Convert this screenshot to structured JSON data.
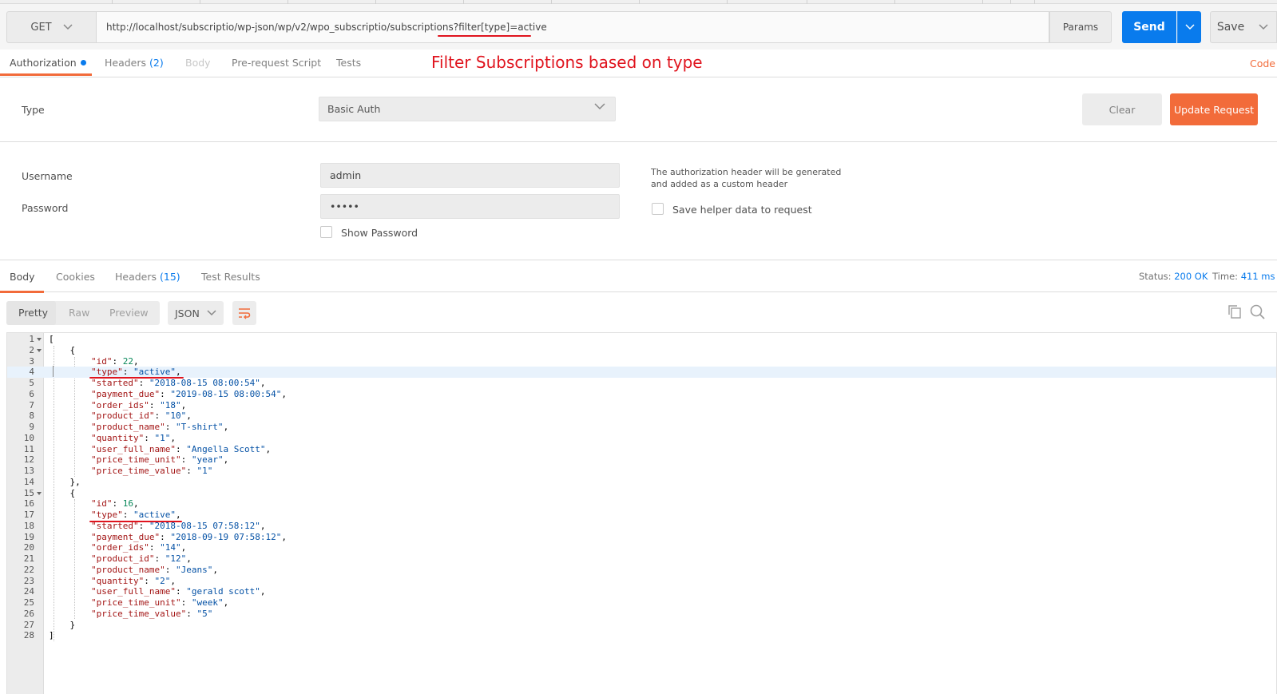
{
  "request": {
    "method": "GET",
    "url": "http://localhost/subscriptio/wp-json/wp/v2/wpo_subscriptio/subscriptions?filter[type]=active",
    "params_label": "Params",
    "send_label": "Send",
    "save_label": "Save"
  },
  "request_tabs": {
    "authorization": "Authorization",
    "headers": "Headers",
    "headers_count": "(2)",
    "body": "Body",
    "prerequest": "Pre-request Script",
    "tests": "Tests",
    "code": "Code"
  },
  "annotation": "Filter Subscriptions based on type",
  "auth": {
    "type_label": "Type",
    "type_value": "Basic Auth",
    "clear_label": "Clear",
    "update_label": "Update Request",
    "username_label": "Username",
    "username_value": "admin",
    "password_label": "Password",
    "password_value": "•••••",
    "show_password_label": "Show Password",
    "hint": "The authorization header will be generated and added as a custom header",
    "save_helper_label": "Save helper data to request"
  },
  "response_tabs": {
    "body": "Body",
    "cookies": "Cookies",
    "headers": "Headers",
    "headers_count": "(15)",
    "test_results": "Test Results",
    "status_label": "Status:",
    "status_value": "200 OK",
    "time_label": "Time:",
    "time_value": "411 ms"
  },
  "view": {
    "pretty": "Pretty",
    "raw": "Raw",
    "preview": "Preview",
    "format": "JSON"
  },
  "colors": {
    "accent_blue": "#097bed",
    "accent_orange": "#f26b3a",
    "annotation_red": "#e0141e"
  },
  "code_lines": [
    {
      "n": "1",
      "fold": true,
      "tokens": [
        {
          "t": "p",
          "v": "["
        }
      ]
    },
    {
      "n": "2",
      "fold": true,
      "tokens": [
        {
          "t": "p",
          "v": "    {"
        }
      ]
    },
    {
      "n": "3",
      "tokens": [
        {
          "t": "p",
          "v": "        "
        },
        {
          "t": "k",
          "v": "\"id\""
        },
        {
          "t": "p",
          "v": ": "
        },
        {
          "t": "n",
          "v": "22"
        },
        {
          "t": "p",
          "v": ","
        }
      ]
    },
    {
      "n": "4",
      "hl": true,
      "tokens": [
        {
          "t": "p",
          "v": "        "
        },
        {
          "t": "k",
          "v": "\"type\""
        },
        {
          "t": "p",
          "v": ": "
        },
        {
          "t": "s",
          "v": "\"active\""
        },
        {
          "t": "p",
          "v": ","
        }
      ]
    },
    {
      "n": "5",
      "tokens": [
        {
          "t": "p",
          "v": "        "
        },
        {
          "t": "k",
          "v": "\"started\""
        },
        {
          "t": "p",
          "v": ": "
        },
        {
          "t": "s",
          "v": "\"2018-08-15 08:00:54\""
        },
        {
          "t": "p",
          "v": ","
        }
      ]
    },
    {
      "n": "6",
      "tokens": [
        {
          "t": "p",
          "v": "        "
        },
        {
          "t": "k",
          "v": "\"payment_due\""
        },
        {
          "t": "p",
          "v": ": "
        },
        {
          "t": "s",
          "v": "\"2019-08-15 08:00:54\""
        },
        {
          "t": "p",
          "v": ","
        }
      ]
    },
    {
      "n": "7",
      "tokens": [
        {
          "t": "p",
          "v": "        "
        },
        {
          "t": "k",
          "v": "\"order_ids\""
        },
        {
          "t": "p",
          "v": ": "
        },
        {
          "t": "s",
          "v": "\"18\""
        },
        {
          "t": "p",
          "v": ","
        }
      ]
    },
    {
      "n": "8",
      "tokens": [
        {
          "t": "p",
          "v": "        "
        },
        {
          "t": "k",
          "v": "\"product_id\""
        },
        {
          "t": "p",
          "v": ": "
        },
        {
          "t": "s",
          "v": "\"10\""
        },
        {
          "t": "p",
          "v": ","
        }
      ]
    },
    {
      "n": "9",
      "tokens": [
        {
          "t": "p",
          "v": "        "
        },
        {
          "t": "k",
          "v": "\"product_name\""
        },
        {
          "t": "p",
          "v": ": "
        },
        {
          "t": "s",
          "v": "\"T-shirt\""
        },
        {
          "t": "p",
          "v": ","
        }
      ]
    },
    {
      "n": "10",
      "tokens": [
        {
          "t": "p",
          "v": "        "
        },
        {
          "t": "k",
          "v": "\"quantity\""
        },
        {
          "t": "p",
          "v": ": "
        },
        {
          "t": "s",
          "v": "\"1\""
        },
        {
          "t": "p",
          "v": ","
        }
      ]
    },
    {
      "n": "11",
      "tokens": [
        {
          "t": "p",
          "v": "        "
        },
        {
          "t": "k",
          "v": "\"user_full_name\""
        },
        {
          "t": "p",
          "v": ": "
        },
        {
          "t": "s",
          "v": "\"Angella Scott\""
        },
        {
          "t": "p",
          "v": ","
        }
      ]
    },
    {
      "n": "12",
      "tokens": [
        {
          "t": "p",
          "v": "        "
        },
        {
          "t": "k",
          "v": "\"price_time_unit\""
        },
        {
          "t": "p",
          "v": ": "
        },
        {
          "t": "s",
          "v": "\"year\""
        },
        {
          "t": "p",
          "v": ","
        }
      ]
    },
    {
      "n": "13",
      "tokens": [
        {
          "t": "p",
          "v": "        "
        },
        {
          "t": "k",
          "v": "\"price_time_value\""
        },
        {
          "t": "p",
          "v": ": "
        },
        {
          "t": "s",
          "v": "\"1\""
        }
      ]
    },
    {
      "n": "14",
      "tokens": [
        {
          "t": "p",
          "v": "    },"
        }
      ]
    },
    {
      "n": "15",
      "fold": true,
      "tokens": [
        {
          "t": "p",
          "v": "    {"
        }
      ]
    },
    {
      "n": "16",
      "tokens": [
        {
          "t": "p",
          "v": "        "
        },
        {
          "t": "k",
          "v": "\"id\""
        },
        {
          "t": "p",
          "v": ": "
        },
        {
          "t": "n",
          "v": "16"
        },
        {
          "t": "p",
          "v": ","
        }
      ]
    },
    {
      "n": "17",
      "tokens": [
        {
          "t": "p",
          "v": "        "
        },
        {
          "t": "k",
          "v": "\"type\""
        },
        {
          "t": "p",
          "v": ": "
        },
        {
          "t": "s",
          "v": "\"active\""
        },
        {
          "t": "p",
          "v": ","
        }
      ]
    },
    {
      "n": "18",
      "tokens": [
        {
          "t": "p",
          "v": "        "
        },
        {
          "t": "k",
          "v": "\"started\""
        },
        {
          "t": "p",
          "v": ": "
        },
        {
          "t": "s",
          "v": "\"2018-08-15 07:58:12\""
        },
        {
          "t": "p",
          "v": ","
        }
      ]
    },
    {
      "n": "19",
      "tokens": [
        {
          "t": "p",
          "v": "        "
        },
        {
          "t": "k",
          "v": "\"payment_due\""
        },
        {
          "t": "p",
          "v": ": "
        },
        {
          "t": "s",
          "v": "\"2018-09-19 07:58:12\""
        },
        {
          "t": "p",
          "v": ","
        }
      ]
    },
    {
      "n": "20",
      "tokens": [
        {
          "t": "p",
          "v": "        "
        },
        {
          "t": "k",
          "v": "\"order_ids\""
        },
        {
          "t": "p",
          "v": ": "
        },
        {
          "t": "s",
          "v": "\"14\""
        },
        {
          "t": "p",
          "v": ","
        }
      ]
    },
    {
      "n": "21",
      "tokens": [
        {
          "t": "p",
          "v": "        "
        },
        {
          "t": "k",
          "v": "\"product_id\""
        },
        {
          "t": "p",
          "v": ": "
        },
        {
          "t": "s",
          "v": "\"12\""
        },
        {
          "t": "p",
          "v": ","
        }
      ]
    },
    {
      "n": "22",
      "tokens": [
        {
          "t": "p",
          "v": "        "
        },
        {
          "t": "k",
          "v": "\"product_name\""
        },
        {
          "t": "p",
          "v": ": "
        },
        {
          "t": "s",
          "v": "\"Jeans\""
        },
        {
          "t": "p",
          "v": ","
        }
      ]
    },
    {
      "n": "23",
      "tokens": [
        {
          "t": "p",
          "v": "        "
        },
        {
          "t": "k",
          "v": "\"quantity\""
        },
        {
          "t": "p",
          "v": ": "
        },
        {
          "t": "s",
          "v": "\"2\""
        },
        {
          "t": "p",
          "v": ","
        }
      ]
    },
    {
      "n": "24",
      "tokens": [
        {
          "t": "p",
          "v": "        "
        },
        {
          "t": "k",
          "v": "\"user_full_name\""
        },
        {
          "t": "p",
          "v": ": "
        },
        {
          "t": "s",
          "v": "\"gerald scott\""
        },
        {
          "t": "p",
          "v": ","
        }
      ]
    },
    {
      "n": "25",
      "tokens": [
        {
          "t": "p",
          "v": "        "
        },
        {
          "t": "k",
          "v": "\"price_time_unit\""
        },
        {
          "t": "p",
          "v": ": "
        },
        {
          "t": "s",
          "v": "\"week\""
        },
        {
          "t": "p",
          "v": ","
        }
      ]
    },
    {
      "n": "26",
      "tokens": [
        {
          "t": "p",
          "v": "        "
        },
        {
          "t": "k",
          "v": "\"price_time_value\""
        },
        {
          "t": "p",
          "v": ": "
        },
        {
          "t": "s",
          "v": "\"5\""
        }
      ]
    },
    {
      "n": "27",
      "tokens": [
        {
          "t": "p",
          "v": "    }"
        }
      ]
    },
    {
      "n": "28",
      "tokens": [
        {
          "t": "p",
          "v": "]"
        }
      ]
    }
  ]
}
